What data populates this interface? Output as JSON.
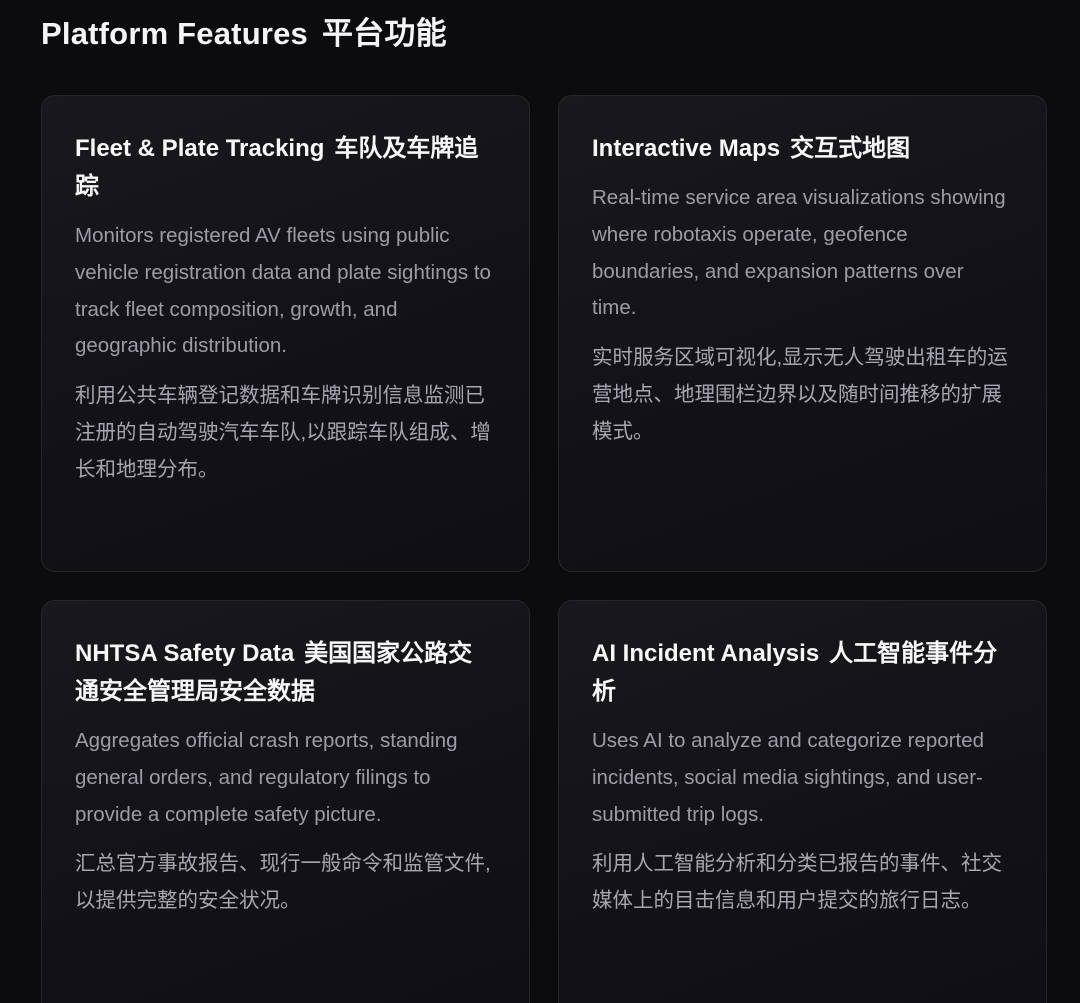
{
  "section": {
    "title_en": "Platform Features",
    "title_zh": "平台功能"
  },
  "cards": [
    {
      "title_en": "Fleet & Plate Tracking",
      "title_zh": "车队及车牌追踪",
      "desc_en": "Monitors registered AV fleets using public vehicle registration data and plate sightings to track fleet composition, growth, and geographic distribution.",
      "desc_zh": "利用公共车辆登记数据和车牌识别信息监测已注册的自动驾驶汽车车队,以跟踪车队组成、增长和地理分布。"
    },
    {
      "title_en": "Interactive Maps",
      "title_zh": "交互式地图",
      "desc_en": "Real-time service area visualizations showing where robotaxis operate, geofence boundaries, and expansion patterns over time.",
      "desc_zh": "实时服务区域可视化,显示无人驾驶出租车的运营地点、地理围栏边界以及随时间推移的扩展模式。"
    },
    {
      "title_en": "NHTSA Safety Data",
      "title_zh": "美国国家公路交通安全管理局安全数据",
      "desc_en": "Aggregates official crash reports, standing general orders, and regulatory filings to provide a complete safety picture.",
      "desc_zh": "汇总官方事故报告、现行一般命令和监管文件,以提供完整的安全状况。"
    },
    {
      "title_en": "AI Incident Analysis",
      "title_zh": "人工智能事件分析",
      "desc_en": "Uses AI to analyze and categorize reported incidents, social media sightings, and user-submitted trip logs.",
      "desc_zh": "利用人工智能分析和分类已报告的事件、社交媒体上的目击信息和用户提交的旅行日志。"
    }
  ]
}
